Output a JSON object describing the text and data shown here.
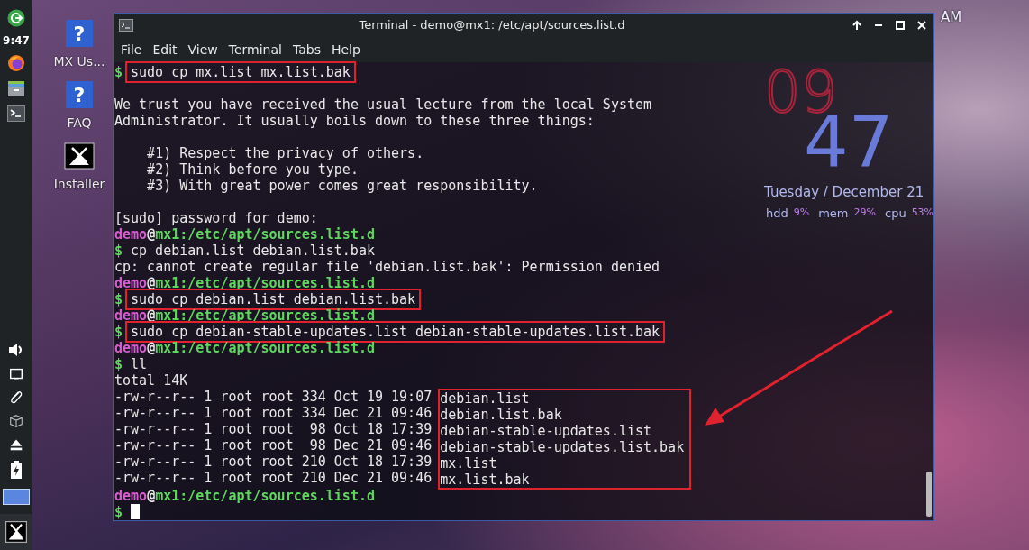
{
  "panel": {
    "clock": "9:47"
  },
  "desktop_icons": [
    {
      "label": "MX Us...",
      "kind": "help",
      "glyph": "?"
    },
    {
      "label": "FAQ",
      "kind": "help",
      "glyph": "?"
    },
    {
      "label": "Installer",
      "kind": "installer"
    }
  ],
  "conky": {
    "hour": "09",
    "minute": "47",
    "ampm": "AM",
    "date": "Tuesday / December 21",
    "stats": [
      {
        "label": "hdd",
        "value": "9%"
      },
      {
        "label": "mem",
        "value": "29%"
      },
      {
        "label": "cpu",
        "value": "53%"
      }
    ]
  },
  "window": {
    "title": "Terminal - demo@mx1: /etc/apt/sources.list.d",
    "menu": [
      "File",
      "Edit",
      "View",
      "Terminal",
      "Tabs",
      "Help"
    ]
  },
  "terminal": {
    "lines": [
      {
        "kind": "command",
        "symbol": "$",
        "text": "sudo cp mx.list mx.list.bak",
        "highlighted": true
      },
      {
        "kind": "blank"
      },
      {
        "kind": "output",
        "text": "We trust you have received the usual lecture from the local System"
      },
      {
        "kind": "output",
        "text": "Administrator. It usually boils down to these three things:"
      },
      {
        "kind": "blank"
      },
      {
        "kind": "output",
        "text": "    #1) Respect the privacy of others."
      },
      {
        "kind": "output",
        "text": "    #2) Think before you type."
      },
      {
        "kind": "output",
        "text": "    #3) With great power comes great responsibility."
      },
      {
        "kind": "blank"
      },
      {
        "kind": "output",
        "text": "[sudo] password for demo:"
      },
      {
        "kind": "prompt",
        "user": "demo",
        "at": "@",
        "host": "mx1",
        "path": ":/etc/apt/sources.list.d"
      },
      {
        "kind": "command",
        "symbol": "$",
        "text": "cp debian.list debian.list.bak",
        "highlighted": false
      },
      {
        "kind": "output",
        "text": "cp: cannot create regular file 'debian.list.bak': Permission denied"
      },
      {
        "kind": "prompt",
        "user": "demo",
        "at": "@",
        "host": "mx1",
        "path": ":/etc/apt/sources.list.d"
      },
      {
        "kind": "command",
        "symbol": "$",
        "text": "sudo cp debian.list debian.list.bak",
        "highlighted": true
      },
      {
        "kind": "prompt",
        "user": "demo",
        "at": "@",
        "host": "mx1",
        "path": ":/etc/apt/sources.list.d"
      },
      {
        "kind": "command",
        "symbol": "$",
        "text": "sudo cp debian-stable-updates.list debian-stable-updates.list.bak",
        "highlighted": true
      },
      {
        "kind": "prompt",
        "user": "demo",
        "at": "@",
        "host": "mx1",
        "path": ":/etc/apt/sources.list.d"
      },
      {
        "kind": "command",
        "symbol": "$",
        "text": "ll",
        "highlighted": false
      },
      {
        "kind": "output",
        "text": "total 14K"
      },
      {
        "kind": "listing",
        "highlighted": true,
        "rows": [
          {
            "info": "-rw-r--r-- 1 root root 334 Oct 19 19:07",
            "name": "debian.list"
          },
          {
            "info": "-rw-r--r-- 1 root root 334 Dec 21 09:46",
            "name": "debian.list.bak"
          },
          {
            "info": "-rw-r--r-- 1 root root  98 Oct 18 17:39",
            "name": "debian-stable-updates.list"
          },
          {
            "info": "-rw-r--r-- 1 root root  98 Dec 21 09:46",
            "name": "debian-stable-updates.list.bak"
          },
          {
            "info": "-rw-r--r-- 1 root root 210 Oct 18 17:39",
            "name": "mx.list"
          },
          {
            "info": "-rw-r--r-- 1 root root 210 Dec 21 09:46",
            "name": "mx.list.bak"
          }
        ]
      },
      {
        "kind": "prompt",
        "user": "demo",
        "at": "@",
        "host": "mx1",
        "path": ":/etc/apt/sources.list.d"
      },
      {
        "kind": "cursor",
        "symbol": "$"
      }
    ]
  }
}
